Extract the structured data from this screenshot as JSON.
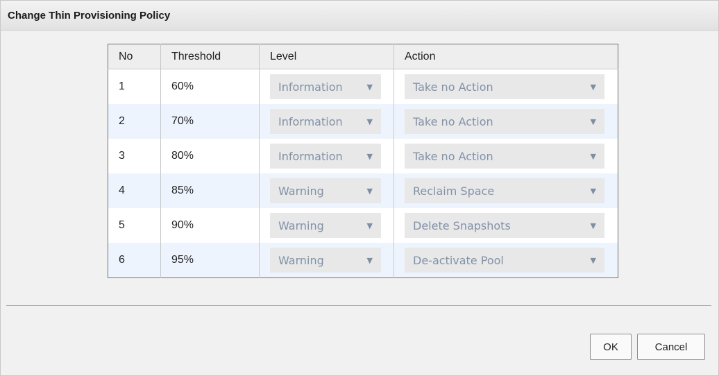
{
  "dialog": {
    "title": "Change Thin Provisioning Policy",
    "ok_label": "OK",
    "cancel_label": "Cancel"
  },
  "table": {
    "headers": {
      "no": "No",
      "threshold": "Threshold",
      "level": "Level",
      "action": "Action"
    },
    "rows": [
      {
        "no": "1",
        "threshold": "60%",
        "level": "Information",
        "action": "Take no Action"
      },
      {
        "no": "2",
        "threshold": "70%",
        "level": "Information",
        "action": "Take no Action"
      },
      {
        "no": "3",
        "threshold": "80%",
        "level": "Information",
        "action": "Take no Action"
      },
      {
        "no": "4",
        "threshold": "85%",
        "level": "Warning",
        "action": "Reclaim Space"
      },
      {
        "no": "5",
        "threshold": "90%",
        "level": "Warning",
        "action": "Delete Snapshots"
      },
      {
        "no": "6",
        "threshold": "95%",
        "level": "Warning",
        "action": "De-activate Pool"
      }
    ]
  },
  "icons": {
    "dropdown_arrow": "▼"
  },
  "colors": {
    "select_bg": "#e8e8e8",
    "select_text": "#8192a8",
    "alt_row_bg": "#eef4fd",
    "header_bg": "#eeeeee"
  }
}
